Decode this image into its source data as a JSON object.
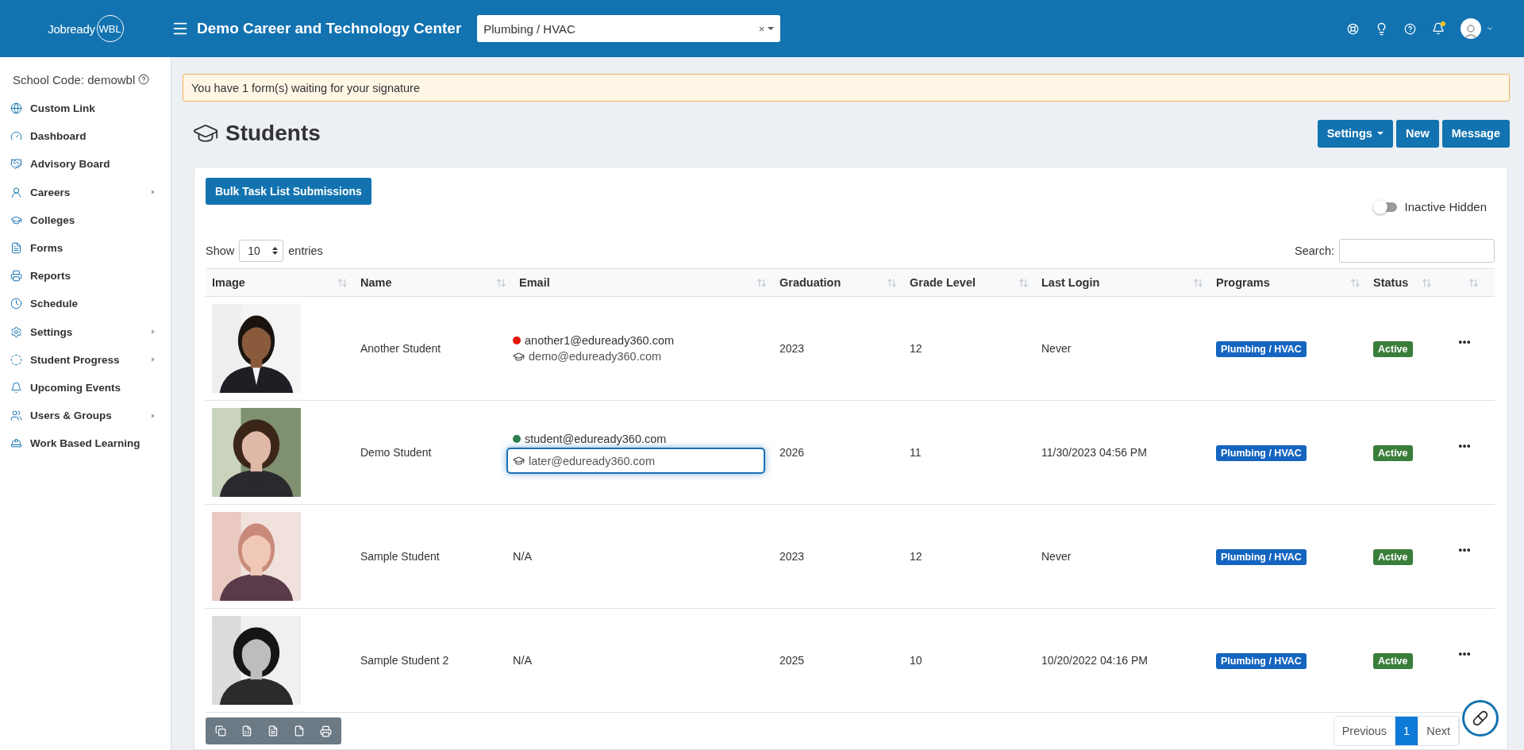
{
  "header": {
    "logo": {
      "word": "Jobready",
      "badge": "WBL"
    },
    "title": "Demo Career and Technology Center",
    "program_select": {
      "value": "Plumbing / HVAC",
      "clear": "×"
    }
  },
  "sidebar": {
    "school_code": "School Code: demowbl",
    "items": [
      {
        "label": "Custom Link",
        "kind": "globe",
        "expandable": false
      },
      {
        "label": "Dashboard",
        "kind": "gauge",
        "expandable": false
      },
      {
        "label": "Advisory Board",
        "kind": "handshake",
        "expandable": false
      },
      {
        "label": "Careers",
        "kind": "person",
        "expandable": true
      },
      {
        "label": "Colleges",
        "kind": "cap",
        "expandable": false
      },
      {
        "label": "Forms",
        "kind": "form",
        "expandable": false
      },
      {
        "label": "Reports",
        "kind": "printer",
        "expandable": false
      },
      {
        "label": "Schedule",
        "kind": "clock",
        "expandable": false
      },
      {
        "label": "Settings",
        "kind": "gears",
        "expandable": true
      },
      {
        "label": "Student Progress",
        "kind": "progress",
        "expandable": true
      },
      {
        "label": "Upcoming Events",
        "kind": "bell",
        "expandable": false
      },
      {
        "label": "Users & Groups",
        "kind": "users",
        "expandable": true
      },
      {
        "label": "Work Based Learning",
        "kind": "worker",
        "expandable": false
      }
    ]
  },
  "alert": "You have 1 form(s) waiting for your signature",
  "page": {
    "title": "Students",
    "buttons": [
      {
        "label": "Settings",
        "dropdown": true
      },
      {
        "label": "New",
        "dropdown": false
      },
      {
        "label": "Message",
        "dropdown": false
      }
    ]
  },
  "toolbar": {
    "bulk_button": "Bulk Task List Submissions",
    "inactive_toggle": {
      "label": "Inactive Hidden",
      "on": false
    }
  },
  "length": {
    "prefix": "Show",
    "value": "10",
    "suffix": "entries"
  },
  "search": {
    "label": "Search:"
  },
  "table": {
    "columns": [
      "Image",
      "Name",
      "Email",
      "Graduation",
      "Grade Level",
      "Last Login",
      "Programs",
      "Status"
    ],
    "rows": [
      {
        "name": "Another Student",
        "emails": [
          {
            "kind": "login",
            "color": "#e3170a",
            "text": "another1@eduready360.com",
            "focused": false
          },
          {
            "kind": "alternate",
            "text": "demo@eduready360.com",
            "focused": false
          }
        ],
        "graduation": "2023",
        "grade": "12",
        "last_login": "Never",
        "program": "Plumbing / HVAC",
        "status": "Active"
      },
      {
        "name": "Demo Student",
        "emails": [
          {
            "kind": "login",
            "color": "#2e7d4f",
            "text": "student@eduready360.com",
            "focused": false
          },
          {
            "kind": "alternate",
            "text": "later@eduready360.com",
            "focused": true
          }
        ],
        "graduation": "2026",
        "grade": "11",
        "last_login": "11/30/2023 04:56 PM",
        "program": "Plumbing / HVAC",
        "status": "Active"
      },
      {
        "name": "Sample Student",
        "emails": [
          {
            "kind": "none",
            "text": "N/A",
            "focused": false
          }
        ],
        "graduation": "2023",
        "grade": "12",
        "last_login": "Never",
        "program": "Plumbing / HVAC",
        "status": "Active"
      },
      {
        "name": "Sample Student 2",
        "emails": [
          {
            "kind": "none",
            "text": "N/A",
            "focused": false
          }
        ],
        "graduation": "2025",
        "grade": "10",
        "last_login": "10/20/2022 04:16 PM",
        "program": "Plumbing / HVAC",
        "status": "Active"
      }
    ]
  },
  "pagination": {
    "previous": "Previous",
    "pages": [
      {
        "label": "1",
        "selected": true
      }
    ],
    "next": "Next"
  }
}
